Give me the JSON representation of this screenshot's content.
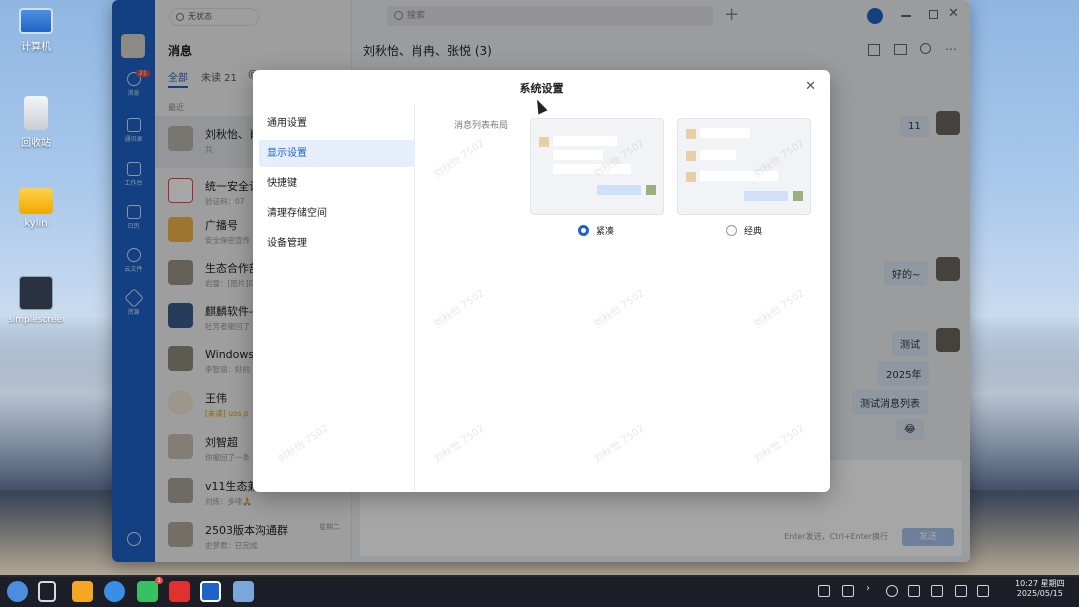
{
  "desktop": {
    "icons": [
      {
        "label": "计算机"
      },
      {
        "label": "回收站"
      },
      {
        "label": "kylin"
      },
      {
        "label": "simplescreenrecorder..."
      }
    ]
  },
  "app": {
    "status": "无状态",
    "search_placeholder": "搜索",
    "add_symbol": "+"
  },
  "rail": {
    "items": [
      {
        "label": "消息",
        "badge": "21"
      },
      {
        "label": "通讯录"
      },
      {
        "label": "工作台"
      },
      {
        "label": "日历"
      },
      {
        "label": "云文件"
      },
      {
        "label": "资源"
      }
    ]
  },
  "list": {
    "title": "消息",
    "tabs": {
      "all": "全部",
      "unread": "未读 21",
      "at": "@"
    },
    "section": "最近",
    "items": [
      {
        "name": "刘秋怡、肖冉",
        "sub": "共",
        "time": ""
      },
      {
        "name": "统一安全认证",
        "sub": "验证码：07",
        "time": ""
      },
      {
        "name": "广播号",
        "sub": "安全保密宣传",
        "time": ""
      },
      {
        "name": "生态合作部",
        "sub": "岩雷：[图片]同",
        "time": ""
      },
      {
        "name": "麒麟软件-大",
        "sub": "牡芳者撤回了",
        "time": ""
      },
      {
        "name": "Windows兼容",
        "sub": "李智丽：好的",
        "time": ""
      },
      {
        "name": "王伟",
        "sub": "[未读] uos p",
        "time": ""
      },
      {
        "name": "刘智超",
        "sub": "你撤回了一条",
        "time": ""
      },
      {
        "name": "v11生态兼容",
        "sub": "刘炼：多嗦🙏",
        "time": ""
      },
      {
        "name": "2503版本沟通群",
        "sub": "史梦君：已完成",
        "time": "星期二"
      }
    ]
  },
  "chat": {
    "title": "刘秋怡、肖冉、张悦 (3)",
    "messages": [
      "11",
      "好的~",
      "测试",
      "2025年",
      "测试消息列表",
      "😂"
    ],
    "hint": "Enter发送，Ctrl+Enter换行",
    "send": "发送"
  },
  "dialog": {
    "title": "系统设置",
    "nav": [
      "通用设置",
      "显示设置",
      "快捷键",
      "清理存储空间",
      "设备管理"
    ],
    "active_index": 1,
    "section_label": "消息列表布局",
    "options": [
      {
        "label": "紧凑",
        "selected": true
      },
      {
        "label": "经典",
        "selected": false
      }
    ],
    "watermark": "刘秋怡 7502"
  },
  "taskbar": {
    "time": "10:27 星期四",
    "date": "2025/05/15",
    "badge": "1"
  },
  "colors": {
    "accent": "#1e63c8",
    "badge": "#e84a4a"
  }
}
